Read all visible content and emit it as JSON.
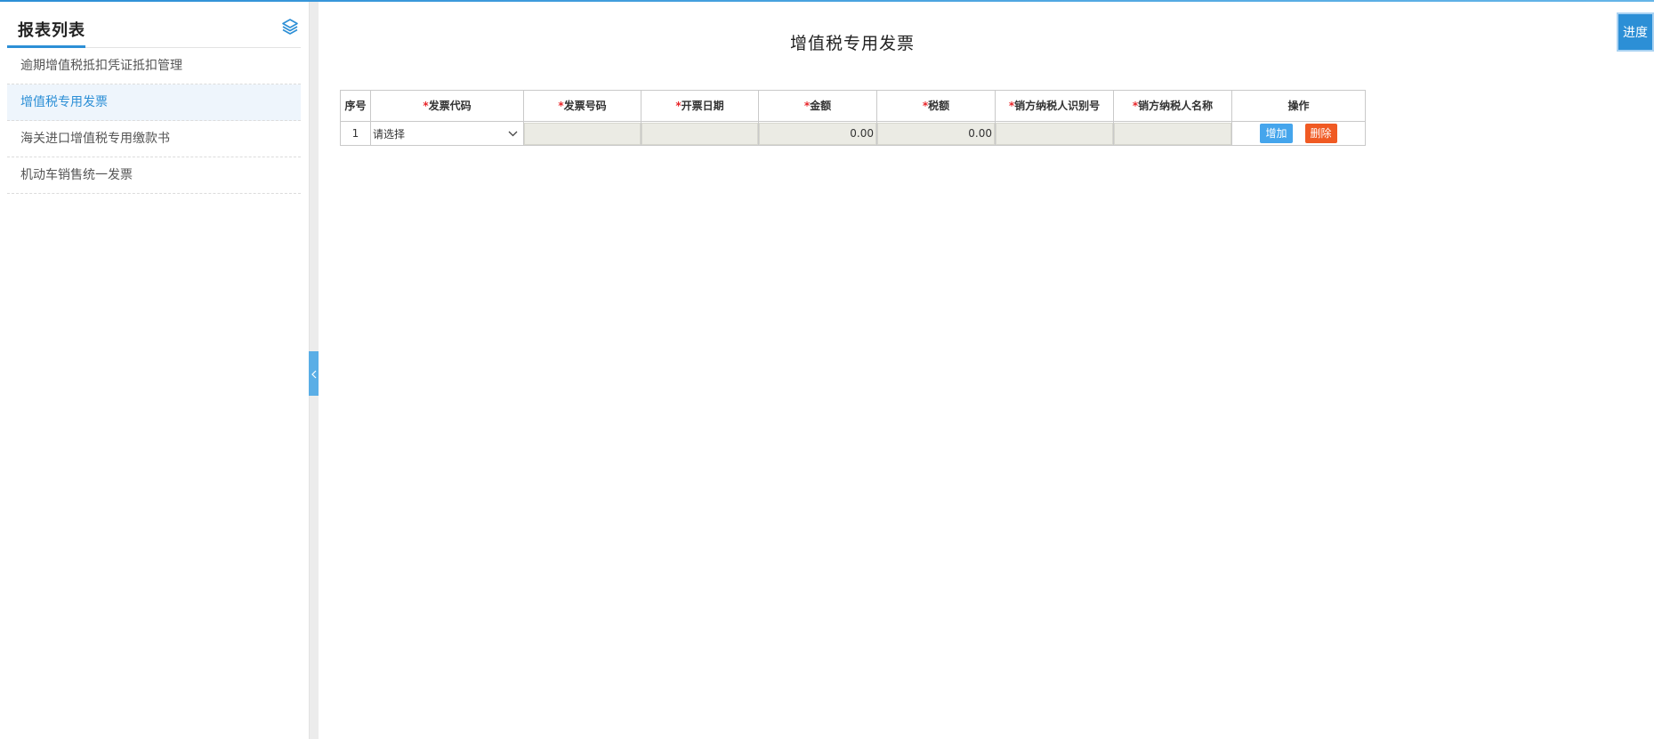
{
  "sidebar": {
    "title": "报表列表",
    "items": [
      {
        "label": "逾期增值税抵扣凭证抵扣管理"
      },
      {
        "label": "增值税专用发票"
      },
      {
        "label": "海关进口增值税专用缴款书"
      },
      {
        "label": "机动车销售统一发票"
      }
    ],
    "active_index": 1,
    "icons": {
      "header": "layers-icon",
      "splitter": "chevron-left-icon"
    }
  },
  "main": {
    "page_title": "增值税专用发票",
    "progress_label": "进度",
    "table": {
      "required_mark": "*",
      "columns": [
        {
          "label": "序号",
          "required": false
        },
        {
          "label": "发票代码",
          "required": true
        },
        {
          "label": "发票号码",
          "required": true
        },
        {
          "label": "开票日期",
          "required": true
        },
        {
          "label": "金额",
          "required": true
        },
        {
          "label": "税额",
          "required": true
        },
        {
          "label": "销方纳税人识别号",
          "required": true
        },
        {
          "label": "销方纳税人名称",
          "required": true
        },
        {
          "label": "操作",
          "required": false
        }
      ],
      "rows": [
        {
          "index": "1",
          "invoice_code_placeholder": "请选择",
          "invoice_number": "",
          "issue_date": "",
          "amount": "0.00",
          "tax": "0.00",
          "seller_tax_id": "",
          "seller_name": "",
          "add_label": "增加",
          "delete_label": "删除"
        }
      ]
    }
  },
  "colors": {
    "accent": "#2c8fd6",
    "active_item_bg": "#eef5fc",
    "required": "#e8262a",
    "add_button": "#45a5ec",
    "delete_button": "#f05a23",
    "readonly_input": "#ebebe4"
  }
}
